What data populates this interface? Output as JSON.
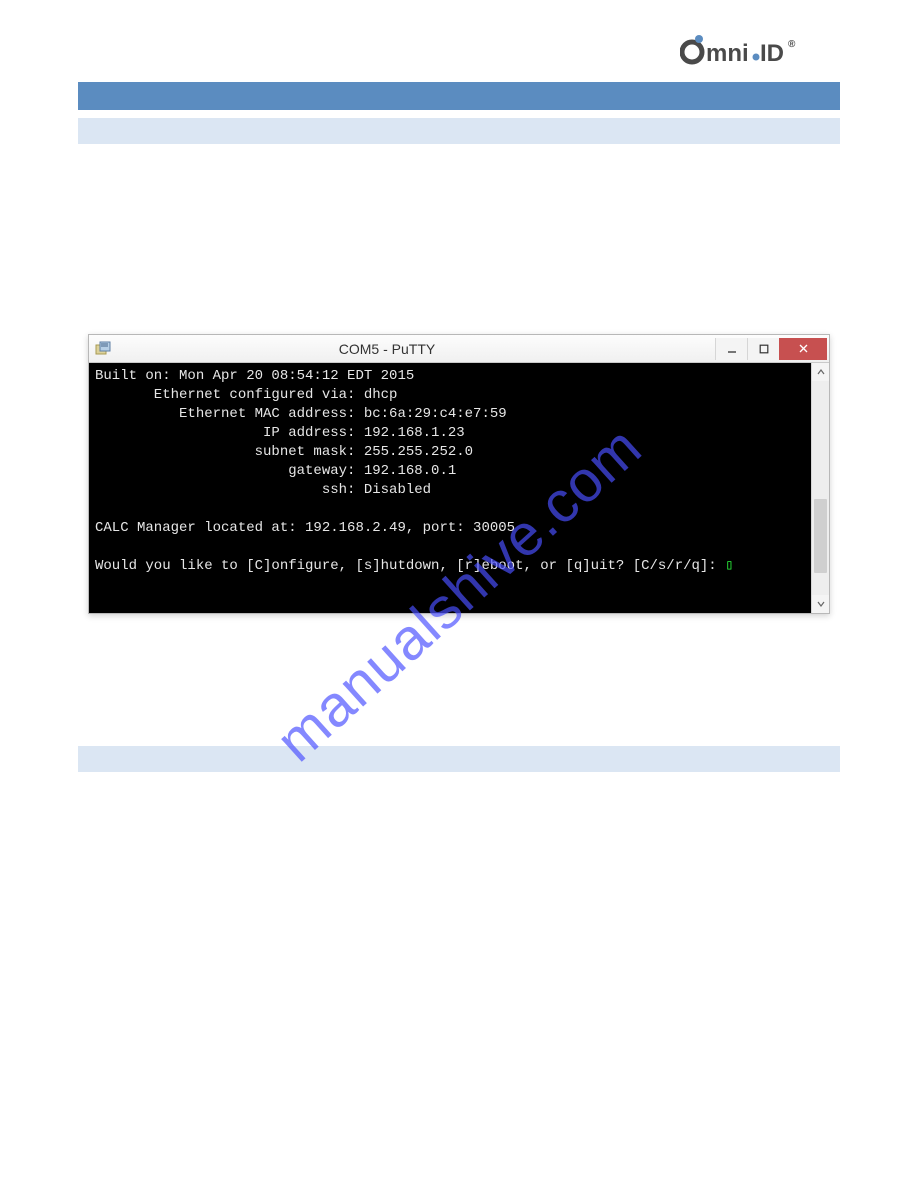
{
  "logo_text": "Omni-ID",
  "window": {
    "title": "COM5 - PuTTY",
    "min_label": "–",
    "max_label": "☐",
    "close_label": "×"
  },
  "terminal": {
    "lines": [
      "Built on: Mon Apr 20 08:54:12 EDT 2015",
      "       Ethernet configured via: dhcp",
      "          Ethernet MAC address: bc:6a:29:c4:e7:59",
      "                    IP address: 192.168.1.23",
      "                   subnet mask: 255.255.252.0",
      "                       gateway: 192.168.0.1",
      "                           ssh: Disabled",
      "",
      "CALC Manager located at: 192.168.2.49, port: 30005",
      "",
      "Would you like to [C]onfigure, [s]hutdown, [r]eboot, or [q]uit? [C/s/r/q]: "
    ],
    "cursor": "▯"
  },
  "watermark": "manualshive.com"
}
